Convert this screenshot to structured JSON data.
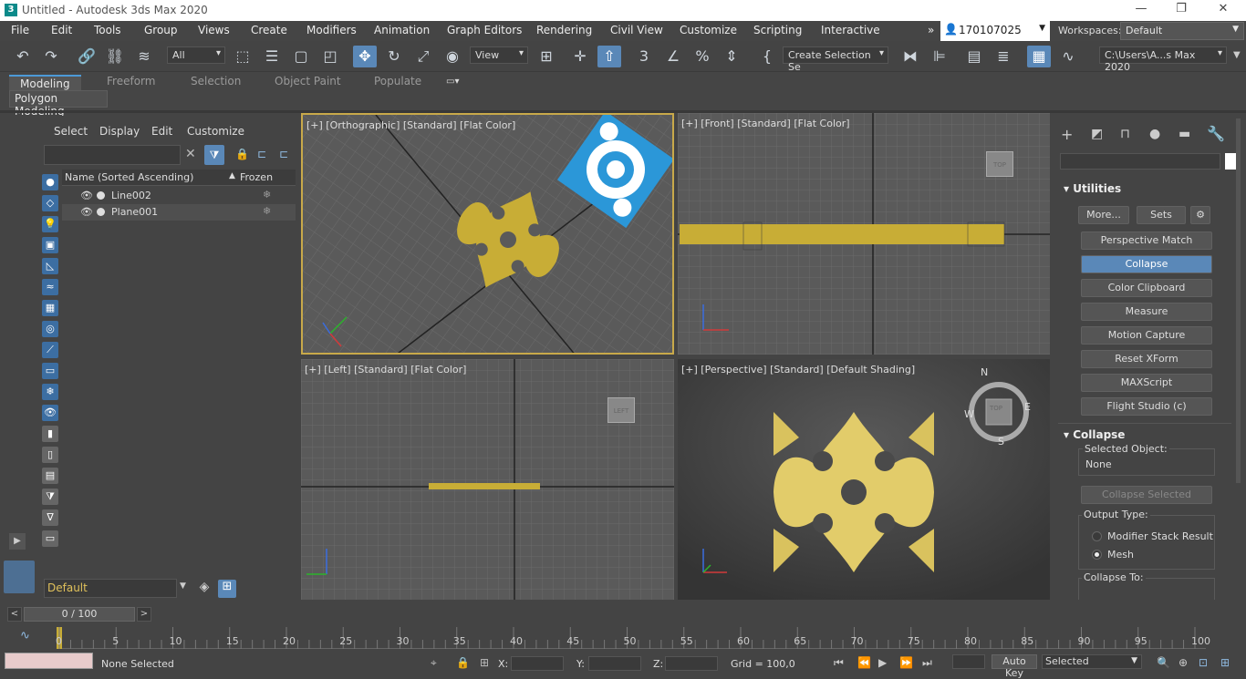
{
  "window": {
    "title": "Untitled - Autodesk 3ds Max 2020",
    "logo": "3",
    "min": "—",
    "restore": "❐",
    "close": "✕"
  },
  "menus": [
    "File",
    "Edit",
    "Tools",
    "Group",
    "Views",
    "Create",
    "Modifiers",
    "Animation",
    "Graph Editors",
    "Rendering",
    "Civil View",
    "Customize",
    "Scripting",
    "Interactive"
  ],
  "account": {
    "id": "170107025",
    "more": "»"
  },
  "workspaces": {
    "label": "Workspaces:",
    "value": "Default"
  },
  "toolbar": {
    "filter": "All",
    "refcoord": "View",
    "selset": "Create Selection Se",
    "path": "C:\\Users\\A...s Max 2020"
  },
  "ribbon": {
    "tabs": [
      "Modeling",
      "Freeform",
      "Selection",
      "Object Paint",
      "Populate"
    ],
    "panel": "Polygon Modeling"
  },
  "explorer": {
    "menus": [
      "Select",
      "Display",
      "Edit",
      "Customize"
    ],
    "col_name": "Name (Sorted Ascending)",
    "col_sort": "▲",
    "col_frozen": "Frozen",
    "rows": [
      "Line002",
      "Plane001"
    ],
    "layer": "Default"
  },
  "viewports": {
    "top_left": "[+] [Orthographic] [Standard] [Flat Color]",
    "top_right": "[+] [Front] [Standard] [Flat Color]",
    "bottom_left": "[+] [Left] [Standard] [Flat Color]",
    "bottom_right": "[+] [Perspective] [Standard] [Default Shading]",
    "cube_top": "TOP",
    "cube_left": "LEFT",
    "compass": {
      "n": "N",
      "s": "S",
      "e": "E",
      "w": "W"
    }
  },
  "cmdpanel": {
    "utilities_title": "Utilities",
    "more": "More...",
    "sets": "Sets",
    "buttons": [
      "Perspective Match",
      "Collapse",
      "Color Clipboard",
      "Measure",
      "Motion Capture",
      "Reset XForm",
      "MAXScript",
      "Flight Studio (c)"
    ],
    "collapse_title": "Collapse",
    "selected_object_label": "Selected Object:",
    "selected_object": "None",
    "collapse_selected": "Collapse Selected",
    "output_type_label": "Output Type:",
    "opt1": "Modifier Stack Result",
    "opt2": "Mesh",
    "collapse_to": "Collapse To:"
  },
  "timeline": {
    "frame": "0 / 100",
    "ticks": [
      "0",
      "5",
      "10",
      "15",
      "20",
      "25",
      "30",
      "35",
      "40",
      "45",
      "50",
      "55",
      "60",
      "65",
      "70",
      "75",
      "80",
      "85",
      "90",
      "95",
      "100"
    ]
  },
  "status": {
    "selection": "None Selected",
    "x": "X:",
    "y": "Y:",
    "z": "Z:",
    "grid": "Grid = 100,0",
    "autokey": "Auto Key",
    "selected": "Selected"
  }
}
